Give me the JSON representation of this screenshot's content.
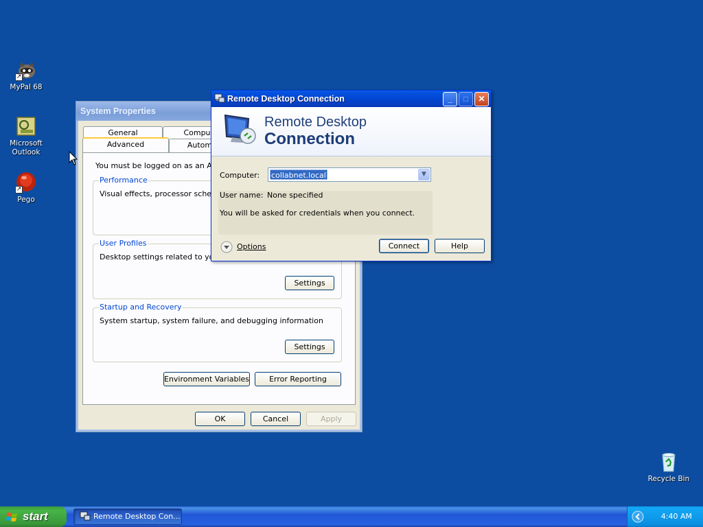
{
  "desktop": {
    "icons": [
      {
        "label": "MyPal 68",
        "icon": "raccoon-icon"
      },
      {
        "label": "Microsoft Outlook",
        "icon": "outlook-icon"
      },
      {
        "label": "Pego",
        "icon": "pego-icon"
      },
      {
        "label": "Recycle Bin",
        "icon": "recycle-bin-icon"
      }
    ]
  },
  "system_properties": {
    "title": "System Properties",
    "tabs": [
      "General",
      "Compu",
      "Advanced",
      "Autom"
    ],
    "intro": "You must be logged on as an Admin",
    "performance": {
      "label": "Performance",
      "text": "Visual effects, processor schedulin"
    },
    "user_profiles": {
      "label": "User Profiles",
      "text": "Desktop settings related to your lo",
      "button": "Settings"
    },
    "startup_recovery": {
      "label": "Startup and Recovery",
      "text": "System startup, system failure, and debugging information",
      "button": "Settings"
    },
    "env_vars": "Environment Variables",
    "error_reporting": "Error Reporting",
    "ok": "OK",
    "cancel": "Cancel",
    "apply": "Apply"
  },
  "rdc": {
    "title": "Remote Desktop Connection",
    "banner_line1": "Remote Desktop",
    "banner_line2": "Connection",
    "computer_label": "Computer:",
    "computer_value": "collabnet.local",
    "username_label": "User name:",
    "username_value": "None specified",
    "credentials_note": "You will be asked for credentials when you connect.",
    "options": "Options",
    "connect": "Connect",
    "help": "Help",
    "minimize": "_",
    "maximize": "□",
    "close": "✕"
  },
  "taskbar": {
    "start": "start",
    "task": "Remote Desktop Con...",
    "clock": "4:40 AM"
  },
  "colors": {
    "desktop": "#0c4da2",
    "titlebar_active": "#0246d2",
    "start_green": "#3a983a"
  }
}
